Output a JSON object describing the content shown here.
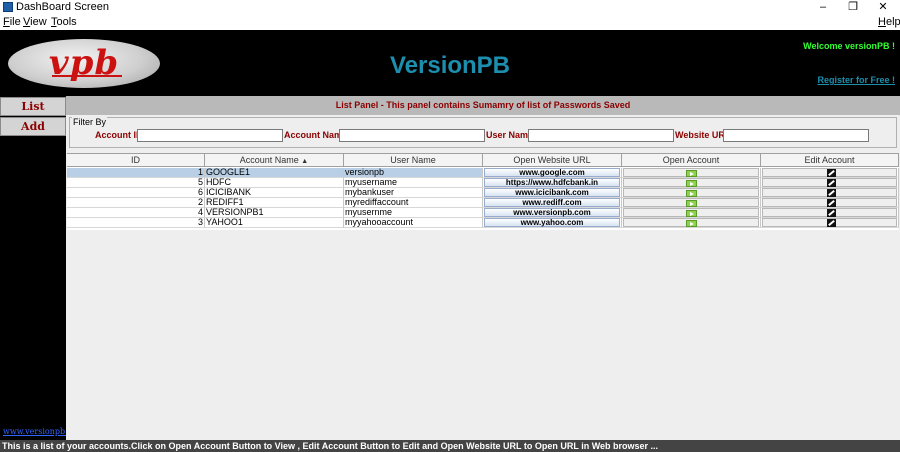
{
  "window": {
    "title": "DashBoard Screen",
    "min_glyph": "–",
    "max_glyph": "❐",
    "close_glyph": "✕"
  },
  "menu": {
    "file": "File",
    "view": "View",
    "tools": "Tools",
    "help": "Help"
  },
  "header": {
    "logo_text": "vpb",
    "app_title": "VersionPB",
    "welcome": "Welcome versionPB !",
    "register": "Register for Free !"
  },
  "sidebar": {
    "list_label": "List",
    "add_label": "Add",
    "site_link": "www.versionpb.com"
  },
  "panel": {
    "heading": "List Panel - This panel contains Sumamry of list of Passwords Saved"
  },
  "filter": {
    "legend": "Filter By",
    "account_id_label": "Account ID",
    "account_id_value": "",
    "account_name_label": "Account Name",
    "account_name_value": "",
    "user_name_label": "User Name",
    "user_name_value": "",
    "website_url_label": "Website URL",
    "website_url_value": ""
  },
  "table": {
    "columns": [
      "ID",
      "Account Name",
      "User Name",
      "Open Website URL",
      "Open Account",
      "Edit Account"
    ],
    "sort_glyph": "▲",
    "sorted_column": "Account Name",
    "selected_row": 0,
    "rows": [
      {
        "id": "1",
        "account_name": "GOOGLE1",
        "user_name": "versionpb",
        "url": "www.google.com"
      },
      {
        "id": "5",
        "account_name": "HDFC",
        "user_name": "myusername",
        "url": "https://www.hdfcbank.in"
      },
      {
        "id": "6",
        "account_name": "ICICIBANK",
        "user_name": "mybankuser",
        "url": "www.icicibank.com"
      },
      {
        "id": "2",
        "account_name": "REDIFF1",
        "user_name": "myrediffaccount",
        "url": "www.rediff.com"
      },
      {
        "id": "4",
        "account_name": "VERSIONPB1",
        "user_name": "myusernme",
        "url": "www.versionpb.com"
      },
      {
        "id": "3",
        "account_name": "YAHOO1",
        "user_name": "myyahooaccount",
        "url": "www.yahoo.com"
      }
    ]
  },
  "statusbar": {
    "text": "This is a list of your accounts.Click on Open Account Button to View , Edit Account Button to Edit and Open Website URL to Open URL in Web browser ..."
  },
  "colors": {
    "brand_teal": "#1c8fae",
    "welcome_green": "#33ff33",
    "label_maroon": "#8b0000",
    "logo_red": "#cc1111"
  },
  "icons": {
    "open_account": "green-arrow-icon",
    "edit_account": "edit-pencil-icon"
  }
}
